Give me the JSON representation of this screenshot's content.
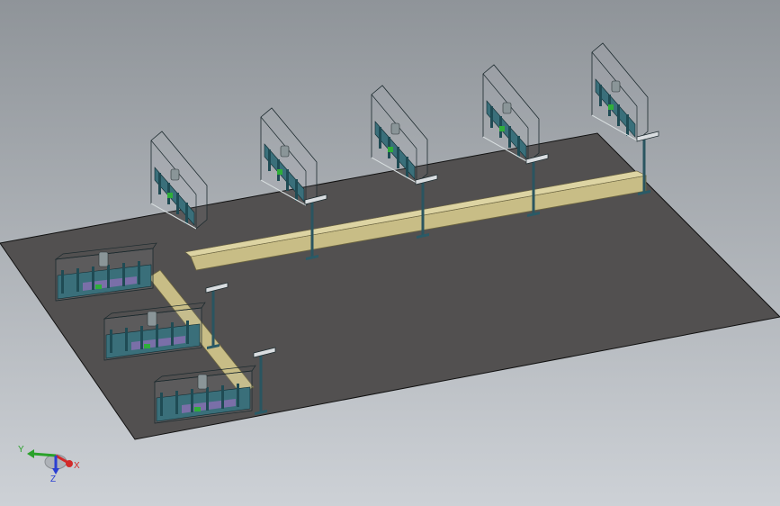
{
  "viewport": {
    "background_top": "#8f9499",
    "background_bottom": "#cdd1d6"
  },
  "floor": {
    "color": "#525050",
    "edge_color": "#111111"
  },
  "conveyor": {
    "color": "#c8bd86",
    "edge_color": "#6b6440"
  },
  "machines": {
    "frame_color": "#3a6f7a",
    "accent_color": "#2fae3a",
    "panel_color": "#7a6fa8",
    "back_row_count": 5,
    "left_row_count": 3
  },
  "lamp_posts": {
    "color": "#2a5560",
    "head_color": "#d9dde0",
    "count": 6
  },
  "triad": {
    "x_label": "X",
    "y_label": "Y",
    "z_label": "Z",
    "x_color": "#d22a2a",
    "y_color": "#2aa12a",
    "z_color": "#2a3fd2"
  }
}
